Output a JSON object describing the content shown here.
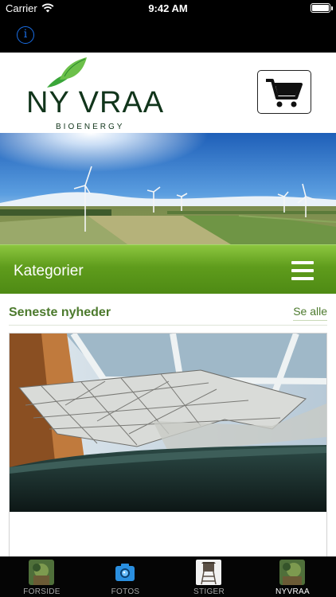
{
  "status_bar": {
    "carrier": "Carrier",
    "time": "9:42 AM"
  },
  "nav": {
    "info_glyph": "i"
  },
  "header": {
    "logo_text": "NY VRAA",
    "logo_subtitle": "BIOENERGY"
  },
  "category_bar": {
    "title": "Kategorier"
  },
  "news": {
    "title": "Seneste nyheder",
    "see_all": "Se alle"
  },
  "tabs": [
    {
      "label": "FORSIDE",
      "icon": "forest-photo-icon",
      "active": false
    },
    {
      "label": "FOTOS",
      "icon": "camera-icon",
      "active": false
    },
    {
      "label": "STIGER",
      "icon": "hunting-tower-icon",
      "active": false
    },
    {
      "label": "NYVRAA",
      "icon": "forest-photo-icon",
      "active": true
    }
  ],
  "colors": {
    "green_bar": "#5f9c1c",
    "brand_green": "#4c7a2d",
    "logo_dark": "#11351b",
    "ios_blue": "#1a6fe8"
  }
}
